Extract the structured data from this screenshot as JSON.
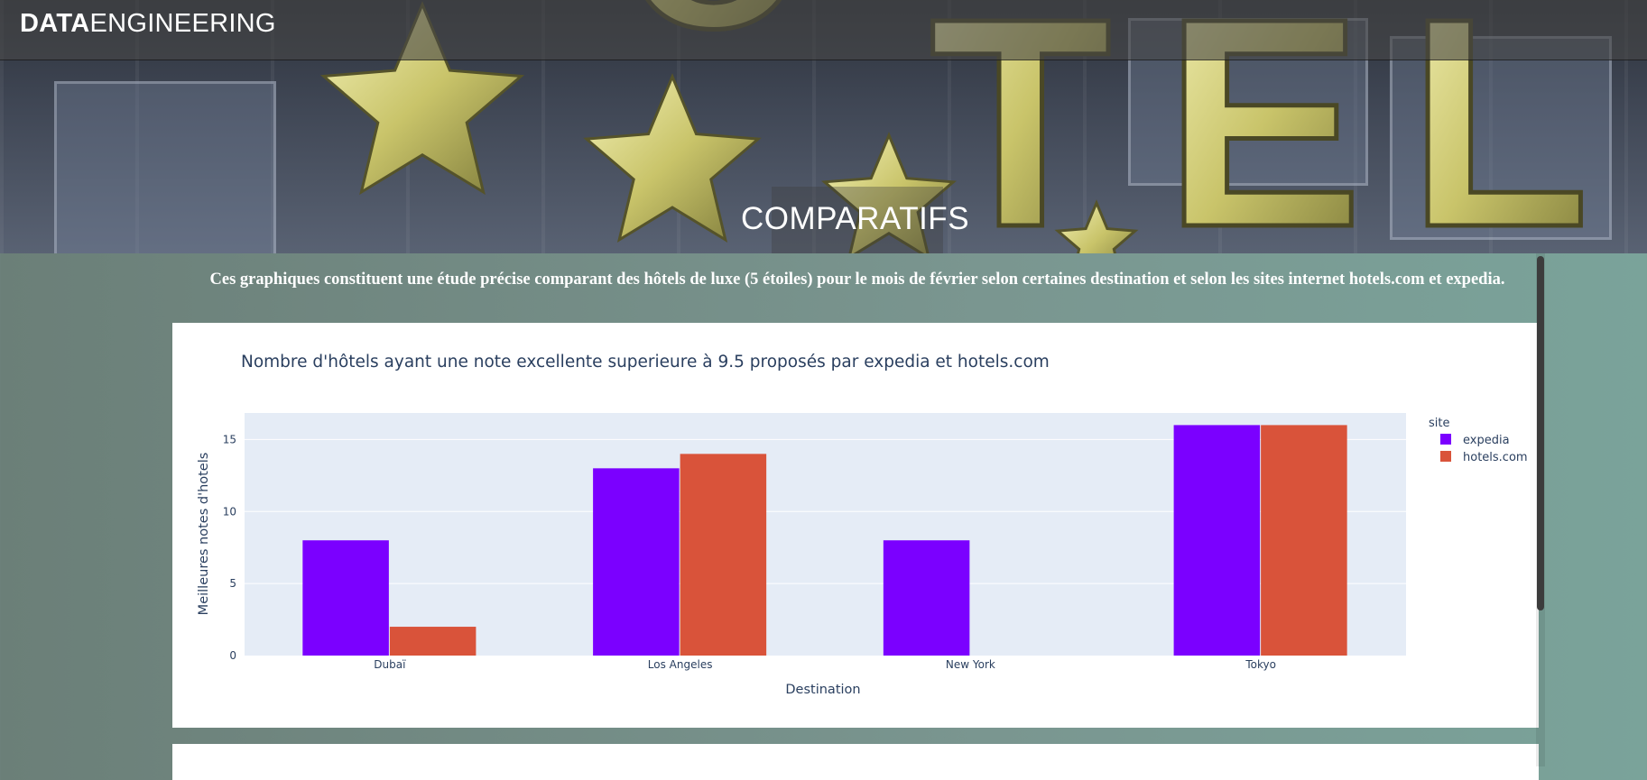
{
  "navbar": {
    "brand_bold": "DATA",
    "brand_light": "ENGINEERING"
  },
  "hero": {
    "title": "COMPARATIFS",
    "sign_letters": [
      "O",
      "T",
      "E",
      "L"
    ]
  },
  "description": "Ces graphiques constituent une étude précise comparant des hôtels de luxe (5 étoiles) pour le mois de février selon certaines destination et selon les sites internet hotels.com et expedia.",
  "colors": {
    "expedia": "#7b00ff",
    "hotels": "#d9533a",
    "plot_bg": "#e5ecf6",
    "text": "#2a3f5f"
  },
  "chart_data": {
    "type": "bar",
    "title": "Nombre d'hôtels ayant une note excellente superieure à 9.5 proposés par expedia et hotels.com",
    "xlabel": "Destination",
    "ylabel": "Meilleures notes d'hotels",
    "categories": [
      "Dubaï",
      "Los Angeles",
      "New York",
      "Tokyo"
    ],
    "yticks": [
      0,
      5,
      10,
      15
    ],
    "ylim": [
      0,
      16.84
    ],
    "legend_title": "site",
    "legend_position": "right",
    "series": [
      {
        "name": "expedia",
        "values": [
          8,
          13,
          8,
          16
        ],
        "color": "#7b00ff"
      },
      {
        "name": "hotels.com",
        "values": [
          2,
          14,
          0,
          16
        ],
        "color": "#d9533a"
      }
    ]
  }
}
